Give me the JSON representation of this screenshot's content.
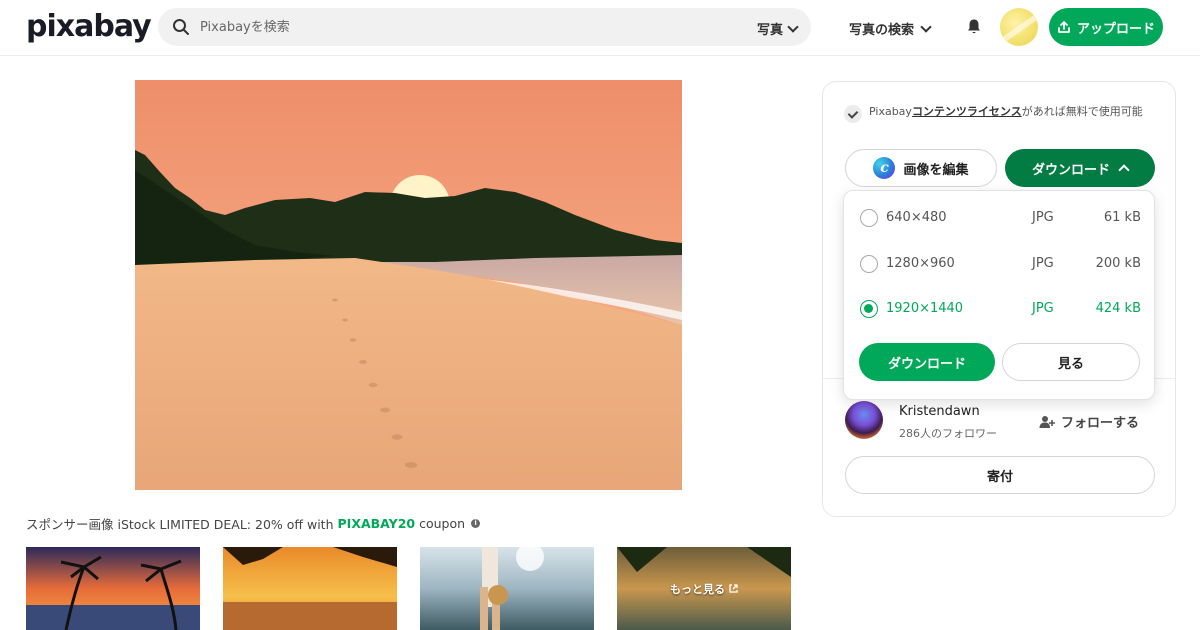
{
  "header": {
    "logo_text": "pixabay",
    "search_placeholder": "Pixabayを検索",
    "search_type": "写真",
    "explore_label": "写真の検索",
    "upload_label": "アップロード"
  },
  "image": {
    "icons": [
      "sunset-beach-photo"
    ]
  },
  "sponsor": {
    "prefix": "スポンサー画像 iStock LIMITED DEAL: 20% off with",
    "code": "PIXABAY20",
    "suffix": "coupon",
    "more_label": "もっと見る"
  },
  "panel": {
    "license_prefix": "Pixabay",
    "license_link": "コンテンツライセンス",
    "license_suffix": "があれば無料で使用可能",
    "edit_label": "画像を編集",
    "download_toggle_label": "ダウンロード",
    "author_name": "Kristendawn",
    "author_followers": "286人のフォロワー",
    "follow_label": "フォローする",
    "donate_label": "寄付"
  },
  "dropdown": {
    "options": [
      {
        "resolution": "640×480",
        "format": "JPG",
        "size": "61 kB",
        "selected": false
      },
      {
        "resolution": "1280×960",
        "format": "JPG",
        "size": "200 kB",
        "selected": false
      },
      {
        "resolution": "1920×1440",
        "format": "JPG",
        "size": "424 kB",
        "selected": true
      }
    ],
    "download_label": "ダウンロード",
    "view_label": "見る"
  },
  "colors": {
    "brand_green": "#02a85a",
    "dark_green": "#027c43"
  }
}
